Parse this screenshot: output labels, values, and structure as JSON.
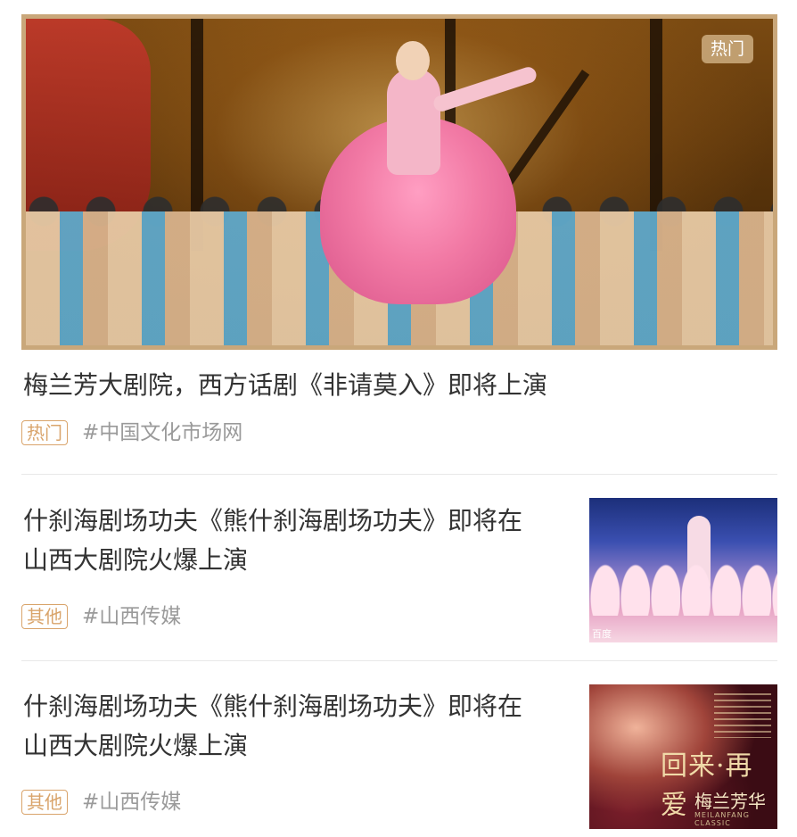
{
  "feed": {
    "featured": {
      "hot_tag": "热门",
      "title": "梅兰芳大剧院，西方话剧《非请莫入》即将上演",
      "category": "热门",
      "source": "#中国文化市场网",
      "image_alt": "stage-dance-performance"
    },
    "items": [
      {
        "title_line1": "什刹海剧场功夫《熊什刹海剧场功夫》即将在",
        "title_line2": "山西大剧院火爆上演",
        "category": "其他",
        "source": "#山西传媒",
        "thumb_watermark": "百度"
      },
      {
        "title_line1": "什刹海剧场功夫《熊什刹海剧场功夫》即将在",
        "title_line2": "山西大剧院火爆上演",
        "category": "其他",
        "source": "#山西传媒",
        "thumb_poster_title": "回来·再爱",
        "thumb_poster_sub": "梅兰芳华",
        "thumb_poster_en": "MEILANFANG CLASSIC"
      }
    ]
  },
  "colors": {
    "accent_gold": "#c9a77a",
    "badge_orange": "#d9a46b",
    "title_text": "#333333",
    "source_text": "#9a9a9a",
    "divider": "#e8e8e8"
  }
}
